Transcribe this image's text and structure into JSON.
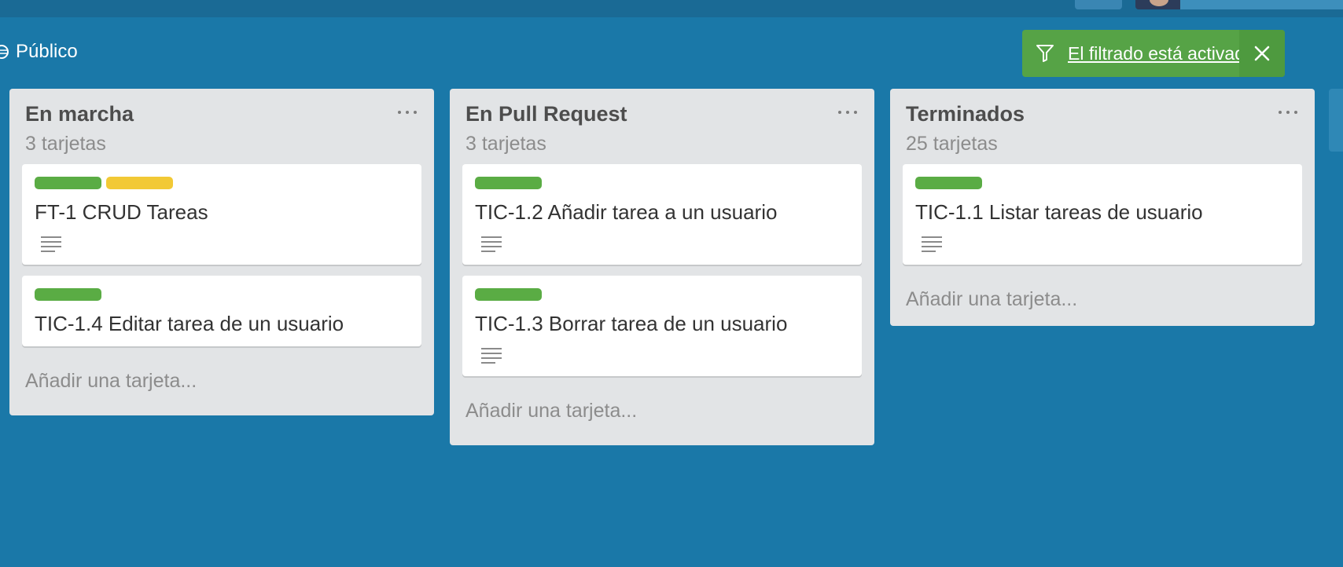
{
  "header": {
    "visibility_label": "Público"
  },
  "filter_banner": {
    "text": "El filtrado está activado."
  },
  "colors": {
    "board_bg": "#1a78a8",
    "label_green": "#5aac44",
    "label_yellow": "#f2c935",
    "banner_green": "#56a346"
  },
  "lists": [
    {
      "title": "En marcha",
      "count": "3 tarjetas",
      "add_card": "Añadir una tarjeta...",
      "cards": [
        {
          "title": "FT-1 CRUD Tareas",
          "labels": [
            "green",
            "yellow"
          ],
          "has_description": true
        },
        {
          "title": "TIC-1.4 Editar tarea de un usuario",
          "labels": [
            "green"
          ],
          "has_description": false
        }
      ]
    },
    {
      "title": "En Pull Request",
      "count": "3 tarjetas",
      "add_card": "Añadir una tarjeta...",
      "cards": [
        {
          "title": "TIC-1.2 Añadir tarea a un usuario",
          "labels": [
            "green"
          ],
          "has_description": true
        },
        {
          "title": "TIC-1.3 Borrar tarea de un usuario",
          "labels": [
            "green"
          ],
          "has_description": true
        }
      ]
    },
    {
      "title": "Terminados",
      "count": "25 tarjetas",
      "add_card": "Añadir una tarjeta...",
      "cards": [
        {
          "title": "TIC-1.1 Listar tareas de usuario",
          "labels": [
            "green"
          ],
          "has_description": true
        }
      ]
    }
  ]
}
